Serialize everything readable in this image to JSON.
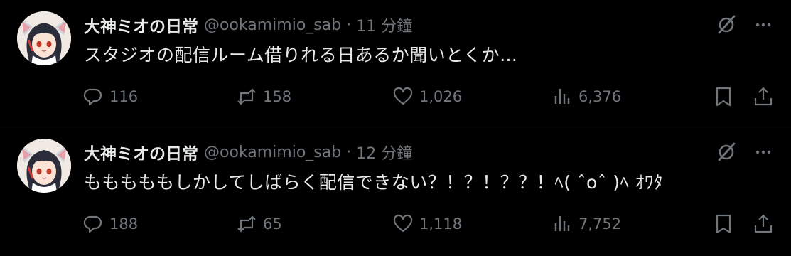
{
  "colors": {
    "background": "#000000",
    "primary_text": "#e7e9ea",
    "secondary_text": "#71767b",
    "divider": "#2f3336"
  },
  "icons": [
    "grok-icon",
    "more-icon",
    "reply-icon",
    "retweet-icon",
    "like-icon",
    "views-icon",
    "bookmark-icon",
    "share-icon"
  ],
  "tweets": [
    {
      "display_name": "大神ミオの日常",
      "handle": "@ookamimio_sab",
      "separator": "·",
      "time": "11 分鐘",
      "text": "スタジオの配信ルーム借りれる日あるか聞いとくか…",
      "replies": "116",
      "retweets": "158",
      "likes": "1,026",
      "views": "6,376"
    },
    {
      "display_name": "大神ミオの日常",
      "handle": "@ookamimio_sab",
      "separator": "·",
      "time": "12 分鐘",
      "text": "もももももしかしてしばらく配信できない？！？！？？！ﾍ( ˆoˆ )ﾍ ｵﾜﾀ",
      "replies": "188",
      "retweets": "65",
      "likes": "1,118",
      "views": "7,752"
    }
  ]
}
